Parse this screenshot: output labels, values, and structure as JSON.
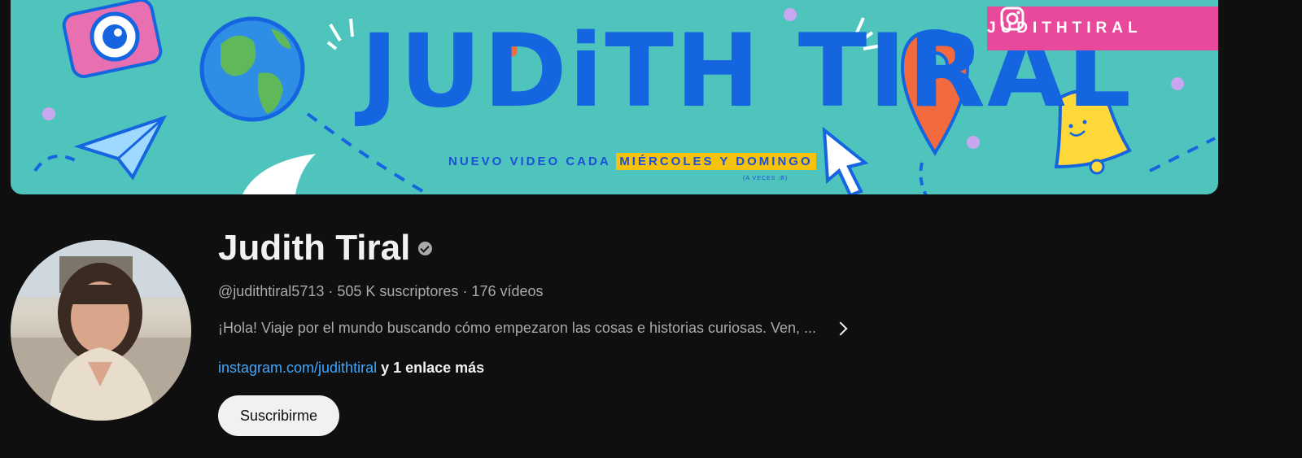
{
  "banner": {
    "title": "JUDiTH TIRAL",
    "instagram_handle": "JUDITHTIRAL",
    "subtitle_prefix": "NUEVO VIDEO CADA",
    "subtitle_highlight": "MIÉRCOLES Y DOMINGO",
    "subtitle_note": "(A VECES :B)",
    "colors": {
      "background": "#4fc4bd",
      "title": "#1565e0",
      "badge": "#e8499a",
      "highlight": "#f5c30e"
    }
  },
  "channel": {
    "name": "Judith Tiral",
    "handle": "@judithtiral5713",
    "separator": " · ",
    "subscribers": "505 K suscriptores",
    "videos": "176 vídeos",
    "description": "¡Hola! Viaje por el mundo buscando cómo empezaron las cosas e historias curiosas. Ven, ...",
    "link": "instagram.com/judithtiral",
    "more_links": "y 1 enlace más",
    "subscribe_label": "Suscribirme",
    "verified_icon": "verified-check-icon"
  }
}
